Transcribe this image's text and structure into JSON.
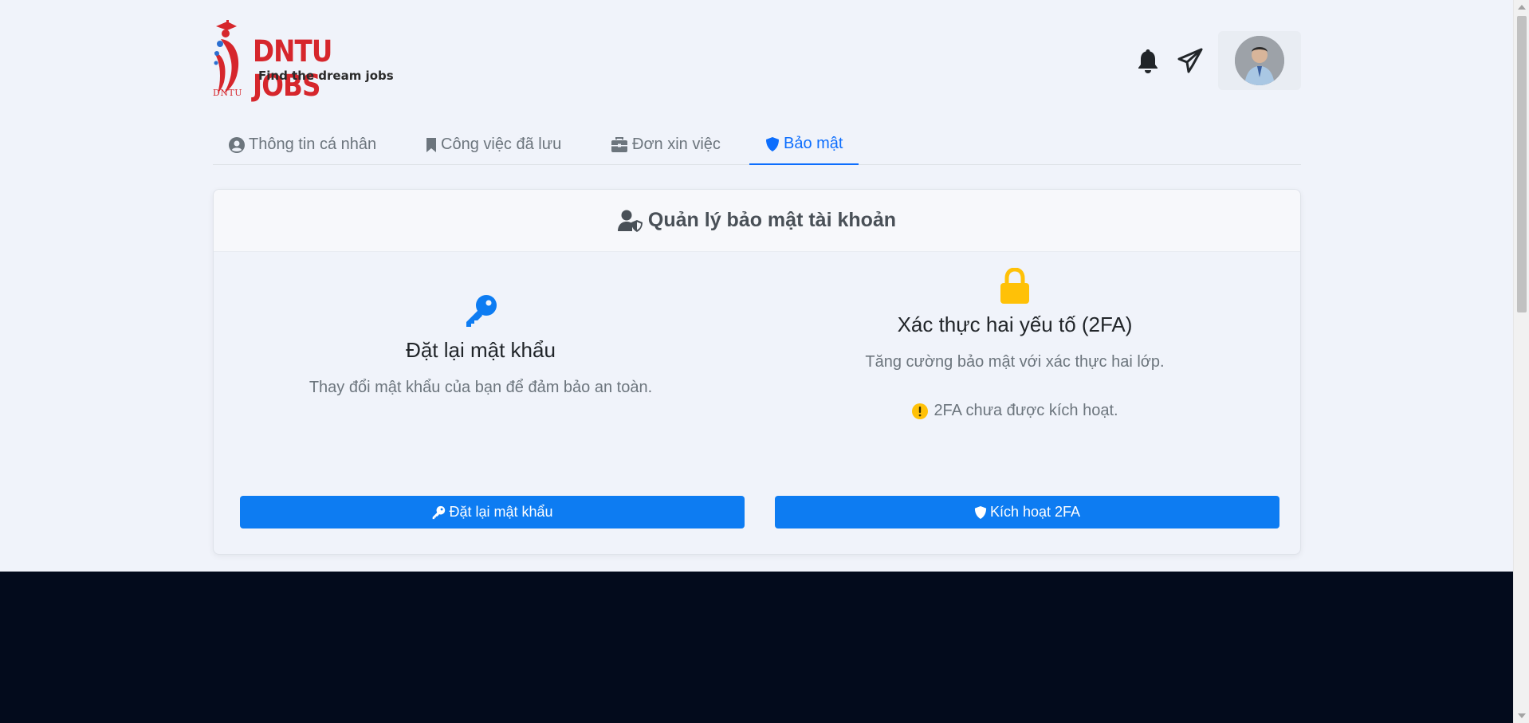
{
  "header": {
    "logo_title": "DNTU JOBS",
    "logo_tagline": "Find the dream jobs",
    "logo_small": "DNTU",
    "icons": [
      "bell-icon",
      "paper-plane-icon"
    ]
  },
  "tabs": [
    {
      "label": "Thông tin cá nhân",
      "icon": "user-circle-icon",
      "active": false
    },
    {
      "label": "Công việc đã lưu",
      "icon": "bookmark-icon",
      "active": false
    },
    {
      "label": "Đơn xin việc",
      "icon": "briefcase-icon",
      "active": false
    },
    {
      "label": "Bảo mật",
      "icon": "shield-icon",
      "active": true
    }
  ],
  "card": {
    "title": "Quản lý bảo mật tài khoản",
    "password": {
      "title": "Đặt lại mật khẩu",
      "description": "Thay đổi mật khẩu của bạn để đảm bảo an toàn.",
      "button": "Đặt lại mật khẩu"
    },
    "twofa": {
      "title": "Xác thực hai yếu tố (2FA)",
      "description": "Tăng cường bảo mật với xác thực hai lớp.",
      "status": "2FA chưa được kích hoạt.",
      "button": "Kích hoạt 2FA"
    }
  },
  "colors": {
    "accent": "#0d7cf2",
    "brand_red": "#d6262c",
    "warning": "#ffc107",
    "footer": "#030b1c"
  }
}
